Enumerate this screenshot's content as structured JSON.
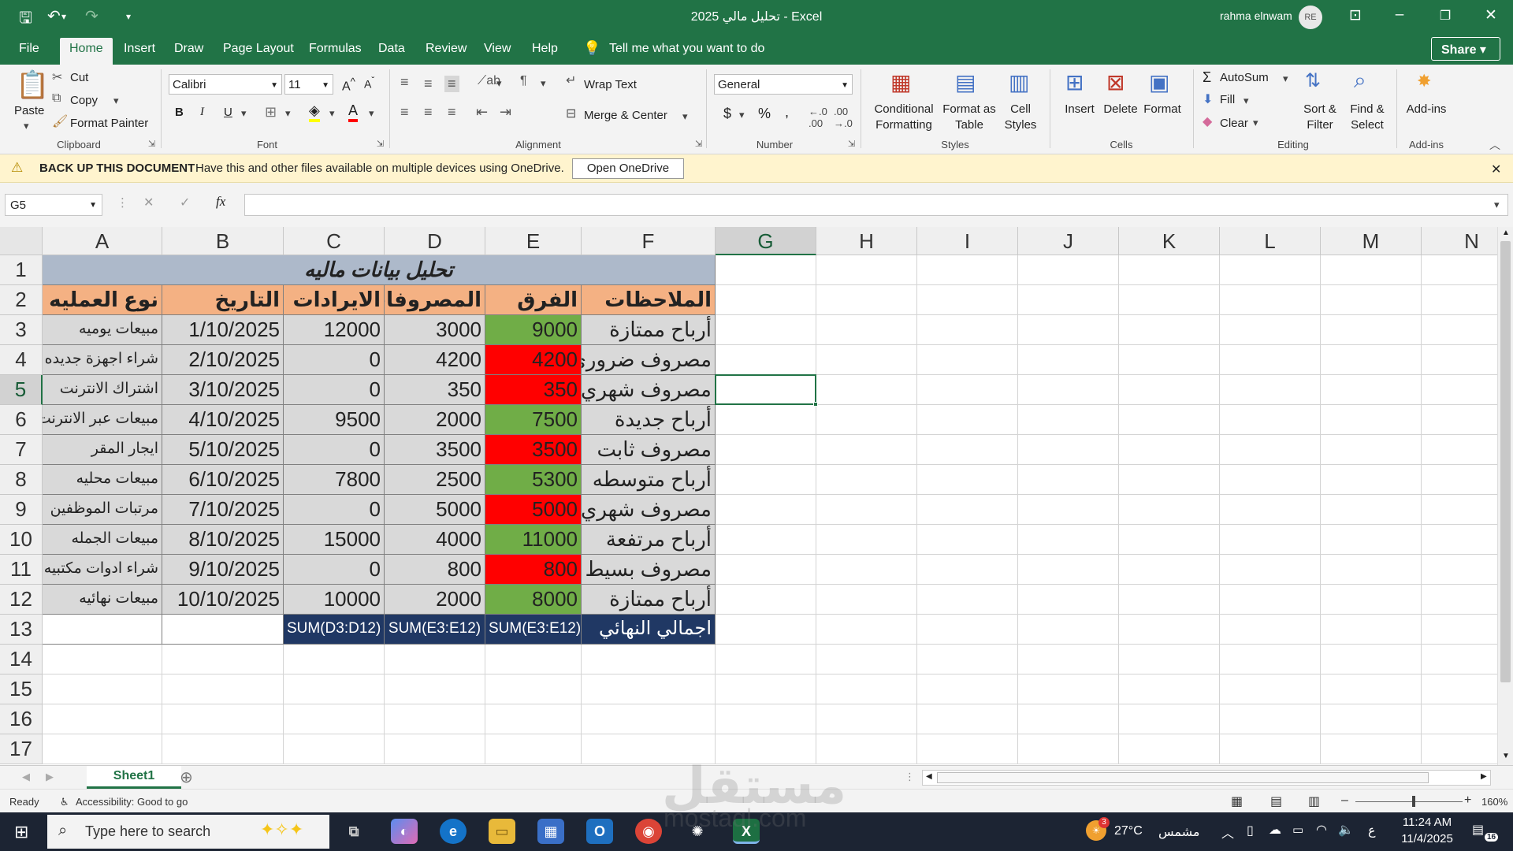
{
  "window": {
    "title": "تحليل مالي 2025  -  Excel",
    "user": "rahma elnwam",
    "avatar": "RE"
  },
  "menu": [
    "File",
    "Home",
    "Insert",
    "Draw",
    "Page Layout",
    "Formulas",
    "Data",
    "Review",
    "View",
    "Help"
  ],
  "tell_me": "Tell me what you want to do",
  "share_label": "Share",
  "ribbon": {
    "clipboard": {
      "paste": "Paste",
      "cut": "Cut",
      "copy": "Copy",
      "format_painter": "Format Painter",
      "label": "Clipboard"
    },
    "font": {
      "name": "Calibri",
      "size": "11",
      "label": "Font"
    },
    "alignment": {
      "wrap": "Wrap Text",
      "merge": "Merge & Center",
      "label": "Alignment"
    },
    "number": {
      "format": "General",
      "label": "Number"
    },
    "styles": {
      "cond": "Conditional",
      "cond2": "Formatting",
      "fmt_table": "Format as",
      "fmt_table2": "Table",
      "cell_styles": "Cell",
      "cell_styles2": "Styles",
      "label": "Styles"
    },
    "cells": {
      "insert": "Insert",
      "delete": "Delete",
      "format": "Format",
      "label": "Cells"
    },
    "editing": {
      "autosum": "AutoSum",
      "fill": "Fill",
      "clear": "Clear",
      "sort": "Sort &",
      "sort2": "Filter",
      "find": "Find &",
      "find2": "Select",
      "label": "Editing"
    },
    "addins": {
      "addins": "Add-ins",
      "label": "Add-ins"
    }
  },
  "message_bar": {
    "title": "BACK UP THIS DOCUMENT",
    "text": "Have this and other files available on multiple devices using OneDrive.",
    "button": "Open OneDrive"
  },
  "name_box": "G5",
  "fx": "fx",
  "columns": [
    "A",
    "B",
    "C",
    "D",
    "E",
    "F",
    "G",
    "H",
    "I",
    "J",
    "K",
    "L",
    "M",
    "N"
  ],
  "rows": [
    "1",
    "2",
    "3",
    "4",
    "5",
    "6",
    "7",
    "8",
    "9",
    "10",
    "11",
    "12",
    "13",
    "14",
    "15",
    "16",
    "17"
  ],
  "sheet": {
    "title": "تحليل بيانات ماليه",
    "headers": [
      "نوع العمليه",
      "التاريخ",
      "الايرادات",
      "المصروفات",
      "الفرق",
      "الملاحظات"
    ],
    "data": [
      [
        "مبيعات يوميه",
        "1/10/2025",
        "12000",
        "3000",
        "9000",
        "أرباح ممتازة"
      ],
      [
        "شراء اجهزة جديده",
        "2/10/2025",
        "0",
        "4200",
        "4200",
        "مصروف ضروري"
      ],
      [
        "اشتراك الانترنت",
        "3/10/2025",
        "0",
        "350",
        "350",
        "مصروف شهري"
      ],
      [
        "مبيعات عبر الانترنت",
        "4/10/2025",
        "9500",
        "2000",
        "7500",
        "أرباح جديدة"
      ],
      [
        "ايجار المقر",
        "5/10/2025",
        "0",
        "3500",
        "3500",
        "مصروف ثابت"
      ],
      [
        "مبيعات محليه",
        "6/10/2025",
        "7800",
        "2500",
        "5300",
        "أرباح متوسطه"
      ],
      [
        "مرتبات الموظفين",
        "7/10/2025",
        "0",
        "5000",
        "5000",
        "مصروف شهري"
      ],
      [
        "مبيعات الجمله",
        "8/10/2025",
        "15000",
        "4000",
        "11000",
        "أرباح مرتفعة"
      ],
      [
        "شراء ادوات مكتبيه",
        "9/10/2025",
        "0",
        "800",
        "800",
        "مصروف بسيط"
      ],
      [
        "مبيعات نهائيه",
        "10/10/2025",
        "10000",
        "2000",
        "8000",
        "أرباح ممتازة"
      ]
    ],
    "diff_status": [
      "profit",
      "loss",
      "loss",
      "profit",
      "loss",
      "profit",
      "loss",
      "profit",
      "loss",
      "profit"
    ],
    "totals": [
      "",
      "",
      "SUM(D3:D12)",
      "SUM(E3:E12)",
      "SUM(E3:E12)",
      "اجمالي النهائي"
    ]
  },
  "colors": {
    "excel_green": "#217346",
    "header_orange": "#f4b183",
    "title_blue": "#adb9ca",
    "data_gray": "#d9d9d9",
    "profit_green": "#70ad47",
    "loss_red": "#ff0000",
    "total_navy": "#203864"
  },
  "sheet_tab": "Sheet1",
  "status": {
    "ready": "Ready",
    "accessibility": "Accessibility: Good to go",
    "zoom": "160%"
  },
  "taskbar": {
    "search": "Type here to search",
    "weather": "27°C",
    "weather_desc": "مشمس",
    "lang": "ع",
    "time": "11:24 AM",
    "date": "11/4/2025",
    "badge": "16",
    "weather_badge": "3"
  },
  "watermark": {
    "text": "مستقل",
    "url": "mostaql.com"
  }
}
